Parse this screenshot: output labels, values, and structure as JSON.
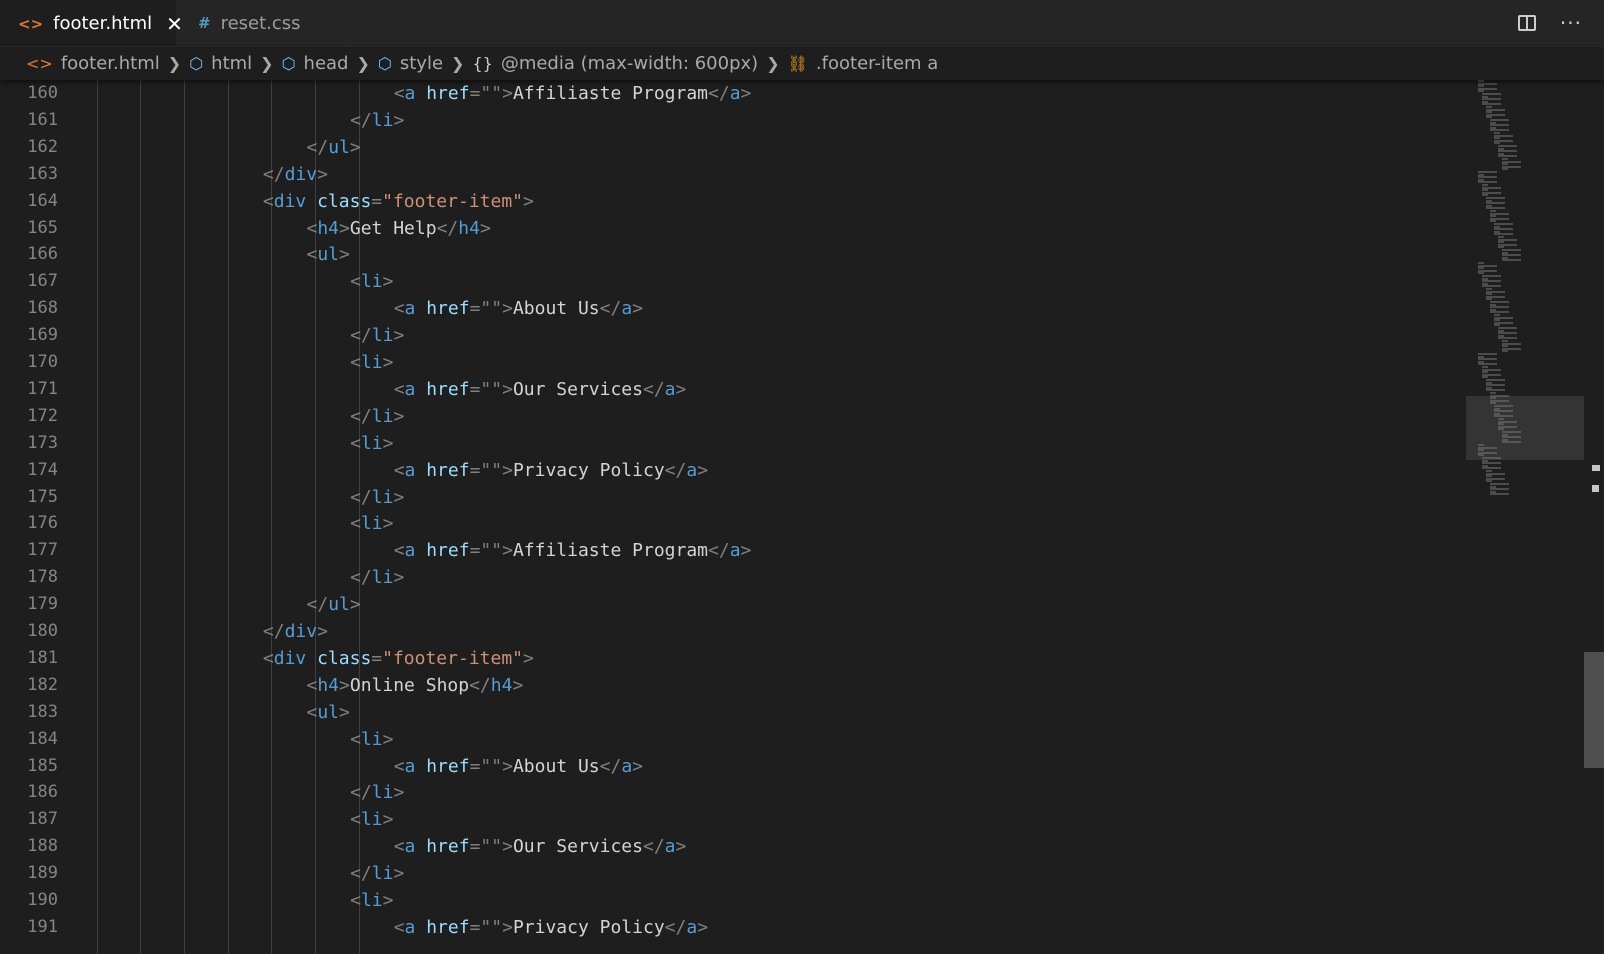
{
  "tabs": [
    {
      "label": "footer.html",
      "icon": "html-file-icon",
      "close": "✕"
    },
    {
      "label": "reset.css",
      "icon": "css-file-icon"
    }
  ],
  "breadcrumb": [
    "footer.html",
    "html",
    "head",
    "style",
    "@media (max-width: 600px)",
    ".footer-item a"
  ],
  "editor": {
    "lines": [
      {
        "n": "160",
        "indent": 7,
        "tokens": [
          [
            "punc",
            "<"
          ],
          [
            "tag",
            "a"
          ],
          [
            "text",
            " "
          ],
          [
            "attr",
            "href"
          ],
          [
            "punc",
            "=\"\">"
          ],
          [
            "text",
            "Affiliaste Program"
          ],
          [
            "punc",
            "</"
          ],
          [
            "tag",
            "a"
          ],
          [
            "punc",
            ">"
          ]
        ]
      },
      {
        "n": "161",
        "indent": 6,
        "tokens": [
          [
            "punc",
            "</"
          ],
          [
            "tag",
            "li"
          ],
          [
            "punc",
            ">"
          ]
        ]
      },
      {
        "n": "162",
        "indent": 5,
        "tokens": [
          [
            "punc",
            "</"
          ],
          [
            "tag",
            "ul"
          ],
          [
            "punc",
            ">"
          ]
        ]
      },
      {
        "n": "163",
        "indent": 4,
        "tokens": [
          [
            "punc",
            "</"
          ],
          [
            "tag",
            "div"
          ],
          [
            "punc",
            ">"
          ]
        ]
      },
      {
        "n": "164",
        "indent": 4,
        "tokens": [
          [
            "punc",
            "<"
          ],
          [
            "tag",
            "div"
          ],
          [
            "text",
            " "
          ],
          [
            "attr",
            "class"
          ],
          [
            "punc",
            "="
          ],
          [
            "str",
            "\"footer-item\""
          ],
          [
            "punc",
            ">"
          ]
        ]
      },
      {
        "n": "165",
        "indent": 5,
        "tokens": [
          [
            "punc",
            "<"
          ],
          [
            "tag",
            "h4"
          ],
          [
            "punc",
            ">"
          ],
          [
            "text",
            "Get Help"
          ],
          [
            "punc",
            "</"
          ],
          [
            "tag",
            "h4"
          ],
          [
            "punc",
            ">"
          ]
        ]
      },
      {
        "n": "166",
        "indent": 5,
        "tokens": [
          [
            "punc",
            "<"
          ],
          [
            "tag",
            "ul"
          ],
          [
            "punc",
            ">"
          ]
        ]
      },
      {
        "n": "167",
        "indent": 6,
        "tokens": [
          [
            "punc",
            "<"
          ],
          [
            "tag",
            "li"
          ],
          [
            "punc",
            ">"
          ]
        ]
      },
      {
        "n": "168",
        "indent": 7,
        "tokens": [
          [
            "punc",
            "<"
          ],
          [
            "tag",
            "a"
          ],
          [
            "text",
            " "
          ],
          [
            "attr",
            "href"
          ],
          [
            "punc",
            "=\"\">"
          ],
          [
            "text",
            "About Us"
          ],
          [
            "punc",
            "</"
          ],
          [
            "tag",
            "a"
          ],
          [
            "punc",
            ">"
          ]
        ]
      },
      {
        "n": "169",
        "indent": 6,
        "tokens": [
          [
            "punc",
            "</"
          ],
          [
            "tag",
            "li"
          ],
          [
            "punc",
            ">"
          ]
        ]
      },
      {
        "n": "170",
        "indent": 6,
        "tokens": [
          [
            "punc",
            "<"
          ],
          [
            "tag",
            "li"
          ],
          [
            "punc",
            ">"
          ]
        ]
      },
      {
        "n": "171",
        "indent": 7,
        "tokens": [
          [
            "punc",
            "<"
          ],
          [
            "tag",
            "a"
          ],
          [
            "text",
            " "
          ],
          [
            "attr",
            "href"
          ],
          [
            "punc",
            "=\"\">"
          ],
          [
            "text",
            "Our Services"
          ],
          [
            "punc",
            "</"
          ],
          [
            "tag",
            "a"
          ],
          [
            "punc",
            ">"
          ]
        ]
      },
      {
        "n": "172",
        "indent": 6,
        "tokens": [
          [
            "punc",
            "</"
          ],
          [
            "tag",
            "li"
          ],
          [
            "punc",
            ">"
          ]
        ]
      },
      {
        "n": "173",
        "indent": 6,
        "tokens": [
          [
            "punc",
            "<"
          ],
          [
            "tag",
            "li"
          ],
          [
            "punc",
            ">"
          ]
        ]
      },
      {
        "n": "174",
        "indent": 7,
        "tokens": [
          [
            "punc",
            "<"
          ],
          [
            "tag",
            "a"
          ],
          [
            "text",
            " "
          ],
          [
            "attr",
            "href"
          ],
          [
            "punc",
            "=\"\">"
          ],
          [
            "text",
            "Privacy Policy"
          ],
          [
            "punc",
            "</"
          ],
          [
            "tag",
            "a"
          ],
          [
            "punc",
            ">"
          ]
        ]
      },
      {
        "n": "175",
        "indent": 6,
        "tokens": [
          [
            "punc",
            "</"
          ],
          [
            "tag",
            "li"
          ],
          [
            "punc",
            ">"
          ]
        ]
      },
      {
        "n": "176",
        "indent": 6,
        "tokens": [
          [
            "punc",
            "<"
          ],
          [
            "tag",
            "li"
          ],
          [
            "punc",
            ">"
          ]
        ]
      },
      {
        "n": "177",
        "indent": 7,
        "tokens": [
          [
            "punc",
            "<"
          ],
          [
            "tag",
            "a"
          ],
          [
            "text",
            " "
          ],
          [
            "attr",
            "href"
          ],
          [
            "punc",
            "=\"\">"
          ],
          [
            "text",
            "Affiliaste Program"
          ],
          [
            "punc",
            "</"
          ],
          [
            "tag",
            "a"
          ],
          [
            "punc",
            ">"
          ]
        ]
      },
      {
        "n": "178",
        "indent": 6,
        "tokens": [
          [
            "punc",
            "</"
          ],
          [
            "tag",
            "li"
          ],
          [
            "punc",
            ">"
          ]
        ]
      },
      {
        "n": "179",
        "indent": 5,
        "tokens": [
          [
            "punc",
            "</"
          ],
          [
            "tag",
            "ul"
          ],
          [
            "punc",
            ">"
          ]
        ]
      },
      {
        "n": "180",
        "indent": 4,
        "tokens": [
          [
            "punc",
            "</"
          ],
          [
            "tag",
            "div"
          ],
          [
            "punc",
            ">"
          ]
        ]
      },
      {
        "n": "181",
        "indent": 4,
        "tokens": [
          [
            "punc",
            "<"
          ],
          [
            "tag",
            "div"
          ],
          [
            "text",
            " "
          ],
          [
            "attr",
            "class"
          ],
          [
            "punc",
            "="
          ],
          [
            "str",
            "\"footer-item\""
          ],
          [
            "punc",
            ">"
          ]
        ]
      },
      {
        "n": "182",
        "indent": 5,
        "tokens": [
          [
            "punc",
            "<"
          ],
          [
            "tag",
            "h4"
          ],
          [
            "punc",
            ">"
          ],
          [
            "text",
            "Online Shop"
          ],
          [
            "punc",
            "</"
          ],
          [
            "tag",
            "h4"
          ],
          [
            "punc",
            ">"
          ]
        ]
      },
      {
        "n": "183",
        "indent": 5,
        "tokens": [
          [
            "punc",
            "<"
          ],
          [
            "tag",
            "ul"
          ],
          [
            "punc",
            ">"
          ]
        ]
      },
      {
        "n": "184",
        "indent": 6,
        "tokens": [
          [
            "punc",
            "<"
          ],
          [
            "tag",
            "li"
          ],
          [
            "punc",
            ">"
          ]
        ]
      },
      {
        "n": "185",
        "indent": 7,
        "tokens": [
          [
            "punc",
            "<"
          ],
          [
            "tag",
            "a"
          ],
          [
            "text",
            " "
          ],
          [
            "attr",
            "href"
          ],
          [
            "punc",
            "=\"\">"
          ],
          [
            "text",
            "About Us"
          ],
          [
            "punc",
            "</"
          ],
          [
            "tag",
            "a"
          ],
          [
            "punc",
            ">"
          ]
        ]
      },
      {
        "n": "186",
        "indent": 6,
        "tokens": [
          [
            "punc",
            "</"
          ],
          [
            "tag",
            "li"
          ],
          [
            "punc",
            ">"
          ]
        ]
      },
      {
        "n": "187",
        "indent": 6,
        "tokens": [
          [
            "punc",
            "<"
          ],
          [
            "tag",
            "li"
          ],
          [
            "punc",
            ">"
          ]
        ]
      },
      {
        "n": "188",
        "indent": 7,
        "tokens": [
          [
            "punc",
            "<"
          ],
          [
            "tag",
            "a"
          ],
          [
            "text",
            " "
          ],
          [
            "attr",
            "href"
          ],
          [
            "punc",
            "=\"\">"
          ],
          [
            "text",
            "Our Services"
          ],
          [
            "punc",
            "</"
          ],
          [
            "tag",
            "a"
          ],
          [
            "punc",
            ">"
          ]
        ]
      },
      {
        "n": "189",
        "indent": 6,
        "tokens": [
          [
            "punc",
            "</"
          ],
          [
            "tag",
            "li"
          ],
          [
            "punc",
            ">"
          ]
        ]
      },
      {
        "n": "190",
        "indent": 6,
        "tokens": [
          [
            "punc",
            "<"
          ],
          [
            "tag",
            "li"
          ],
          [
            "punc",
            ">"
          ]
        ]
      },
      {
        "n": "191",
        "indent": 7,
        "tokens": [
          [
            "punc",
            "<"
          ],
          [
            "tag",
            "a"
          ],
          [
            "text",
            " "
          ],
          [
            "attr",
            "href"
          ],
          [
            "punc",
            "=\"\">"
          ],
          [
            "text",
            "Privacy Policy"
          ],
          [
            "punc",
            "</"
          ],
          [
            "tag",
            "a"
          ],
          [
            "punc",
            ">"
          ]
        ]
      }
    ]
  },
  "colors": {
    "background": "#1e1e1e",
    "tag": "#569cd6",
    "attribute": "#9cdcfe",
    "string": "#ce9178",
    "punctuation": "#808080",
    "text": "#d4d4d4",
    "line_number": "#858585"
  }
}
